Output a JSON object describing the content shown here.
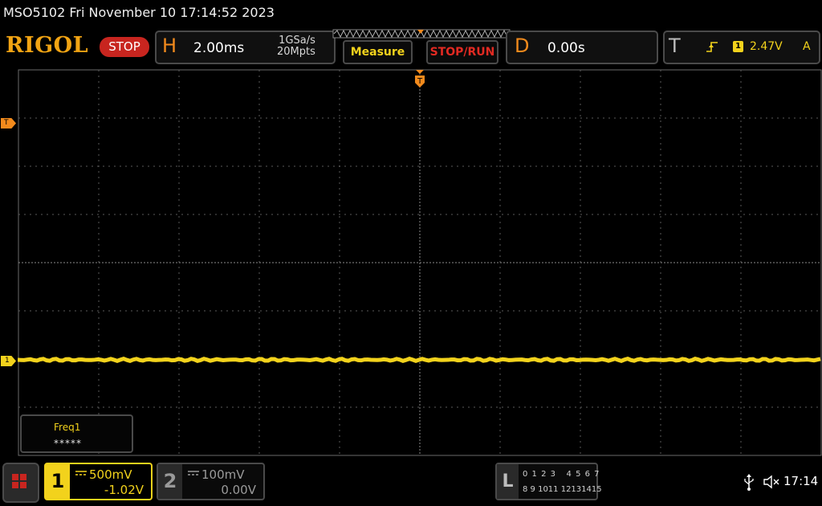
{
  "title_line": "MSO5102  Fri November 10 17:14:52 2023",
  "brand": "RIGOL",
  "run_state": "STOP",
  "horizontal": {
    "letter": "H",
    "timebase": "2.00ms",
    "sample_rate": "1GSa/s",
    "memory_depth": "20Mpts"
  },
  "buttons": {
    "measure": "Measure",
    "stop_run": "STOP/RUN"
  },
  "delay": {
    "letter": "D",
    "value": "0.00s"
  },
  "trigger": {
    "letter": "T",
    "edge_icon": "rising-edge-icon",
    "source": "1",
    "level": "2.47V",
    "mode": "A"
  },
  "markers": {
    "trigger_level": "T",
    "ch1_ground": "1",
    "trigger_position": "T"
  },
  "measurement": {
    "label": "Freq1",
    "value": "*****"
  },
  "channel1": {
    "number": "1",
    "coupling_icon": "dc-coupling-icon",
    "scale": "500mV",
    "offset": "-1.02V"
  },
  "channel2": {
    "number": "2",
    "coupling_icon": "dc-coupling-icon",
    "scale": "100mV",
    "offset": "0.00V"
  },
  "logic": {
    "letter": "L",
    "row1": "0 1 2 3   4 5 6 7",
    "row2": "8 9 1011 12131415"
  },
  "status": {
    "usb_icon": "usb-icon",
    "speaker_icon": "speaker-muted-icon",
    "time": "17:14"
  },
  "colors": {
    "ch1": "#f2d21c",
    "accent_orange": "#f28a1c",
    "stop_red": "#c8251f",
    "grid": "#5a5a5a"
  }
}
